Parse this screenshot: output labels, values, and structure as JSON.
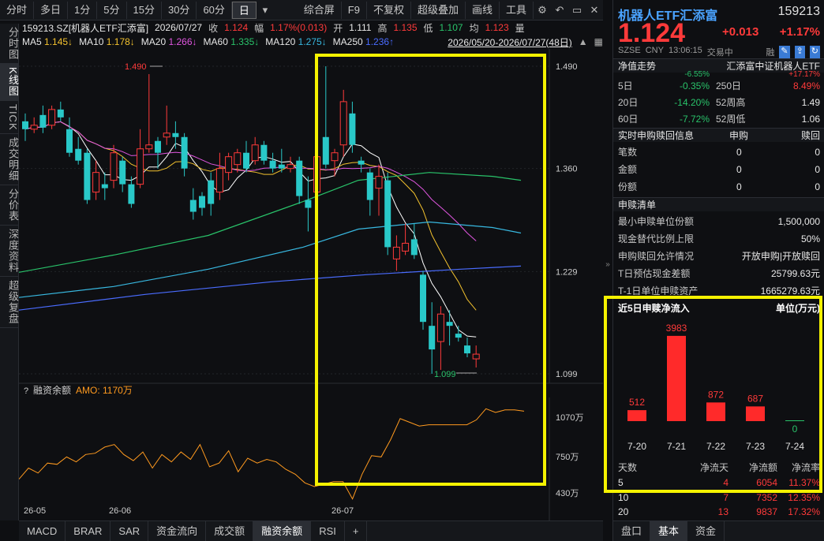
{
  "toolbar": {
    "left_buttons": [
      "分时",
      "多日",
      "1分",
      "5分",
      "15分",
      "30分",
      "60分",
      "日"
    ],
    "active": "日",
    "dropdown_glyph": "▾",
    "right_buttons": [
      "综合屏",
      "F9",
      "不复权",
      "超级叠加",
      "画线",
      "工具"
    ],
    "icons": [
      "gear-icon",
      "back-icon",
      "window-icon",
      "close-icon"
    ]
  },
  "left_tabs": [
    "分时图",
    "K线图",
    "TICK",
    "成交明细",
    "分价表",
    "深度资料",
    "超级复盘"
  ],
  "left_tabs_active": "K线图",
  "info": {
    "title": "159213.SZ[机器人ETF汇添富]",
    "date": "2026/07/27",
    "close_label": "收",
    "close": "1.124",
    "range_label": "幅",
    "range": "1.17%(0.013)",
    "open_label": "开",
    "open": "1.111",
    "high_label": "高",
    "high": "1.135",
    "low_label": "低",
    "low": "1.107",
    "avg_label": "均",
    "avg": "1.123",
    "vol_label": "量"
  },
  "ma": {
    "ma5_label": "MA5",
    "ma5": "1.145↓",
    "ma10_label": "MA10",
    "ma10": "1.178↓",
    "ma20_label": "MA20",
    "ma20": "1.266↓",
    "ma60_label": "MA60",
    "ma60": "1.335↓",
    "ma120_label": "MA120",
    "ma120": "1.275↓",
    "ma250_label": "MA250",
    "ma250": "1.236↑",
    "date_range": "2026/05/20-2026/07/27(48日)"
  },
  "colors": {
    "up": "#ff3a3a",
    "down": "#29c8c8",
    "ma5": "#ffffff",
    "ma10": "#f2c12e",
    "ma20": "#e056e0",
    "ma60": "#29c36a",
    "ma120": "#38b8e0",
    "ma250": "#4a6cff",
    "amo": "#ff9a1f",
    "highlight": "#f5f200"
  },
  "chart_data": {
    "type": "candlestick",
    "y_ticks": [
      "1.490",
      "1.360",
      "1.229",
      "1.099"
    ],
    "ylim": [
      1.099,
      1.49
    ],
    "max_label": "1.490",
    "min_label": "1.099",
    "x_labels": [
      "26-05",
      "26-06",
      "26-07"
    ],
    "indicator_title": "融资余额",
    "indicator_value": "AMO: 1170万",
    "indicator_ticks": [
      "1070万",
      "750万",
      "430万"
    ]
  },
  "right": {
    "name": "机器人ETF汇添富",
    "code": "159213",
    "price": "1.124",
    "change": "+0.013",
    "change_pct": "+1.17%",
    "market": "SZSE",
    "currency": "CNY",
    "time": "13:06:15",
    "status": "交易中",
    "meta_flag": "融",
    "nav_label": "净值走势",
    "nav_name": "汇添富中证机器人ETF",
    "perf_partial_left": "-6.55%",
    "perf_partial_right": "+17.17%",
    "perf": [
      {
        "k1": "5日",
        "v1": "-0.35%",
        "k2": "250日",
        "v2": "8.49%"
      },
      {
        "k1": "20日",
        "v1": "-14.20%",
        "k2": "52周高",
        "v2": "1.49"
      },
      {
        "k1": "60日",
        "v1": "-7.72%",
        "k2": "52周低",
        "v2": "1.06"
      }
    ],
    "sub_header": {
      "label": "实时申购赎回信息",
      "c1": "申购",
      "c2": "赎回"
    },
    "sub_rows": [
      {
        "k": "笔数",
        "a": "0",
        "b": "0"
      },
      {
        "k": "金额",
        "a": "0",
        "b": "0"
      },
      {
        "k": "份额",
        "a": "0",
        "b": "0"
      }
    ],
    "list_header": "申赎清单",
    "list_rows": [
      {
        "k": "最小申赎单位份额",
        "v": "1,500,000"
      },
      {
        "k": "现金替代比例上限",
        "v": "50%"
      },
      {
        "k": "申购赎回允许情况",
        "v": "开放申购|开放赎回"
      },
      {
        "k": "T日预估现金差额",
        "v": "25799.63元"
      },
      {
        "k": "T-1日单位申赎资产",
        "v": "1665279.63元"
      }
    ],
    "flow": {
      "title": "近5日申赎净流入",
      "unit": "单位(万元)",
      "bars": [
        {
          "date": "7-20",
          "value": 512
        },
        {
          "date": "7-21",
          "value": 3983
        },
        {
          "date": "7-22",
          "value": 872
        },
        {
          "date": "7-23",
          "value": 687
        },
        {
          "date": "7-24",
          "value": 0
        }
      ],
      "table_header": [
        "天数",
        "净流天",
        "净流额",
        "净流率"
      ],
      "table_rows": [
        [
          "5",
          "4",
          "6054",
          "11.37%"
        ],
        [
          "10",
          "7",
          "7352",
          "12.35%"
        ],
        [
          "20",
          "13",
          "9837",
          "17.32%"
        ]
      ]
    },
    "bottom_tabs": [
      "盘口",
      "基本",
      "资金"
    ],
    "bottom_active": "基本"
  },
  "bottom_tabs": [
    "MACD",
    "BRAR",
    "SAR",
    "资金流向",
    "成交额",
    "融资余额",
    "RSI",
    "+"
  ],
  "bottom_active": "融资余额"
}
